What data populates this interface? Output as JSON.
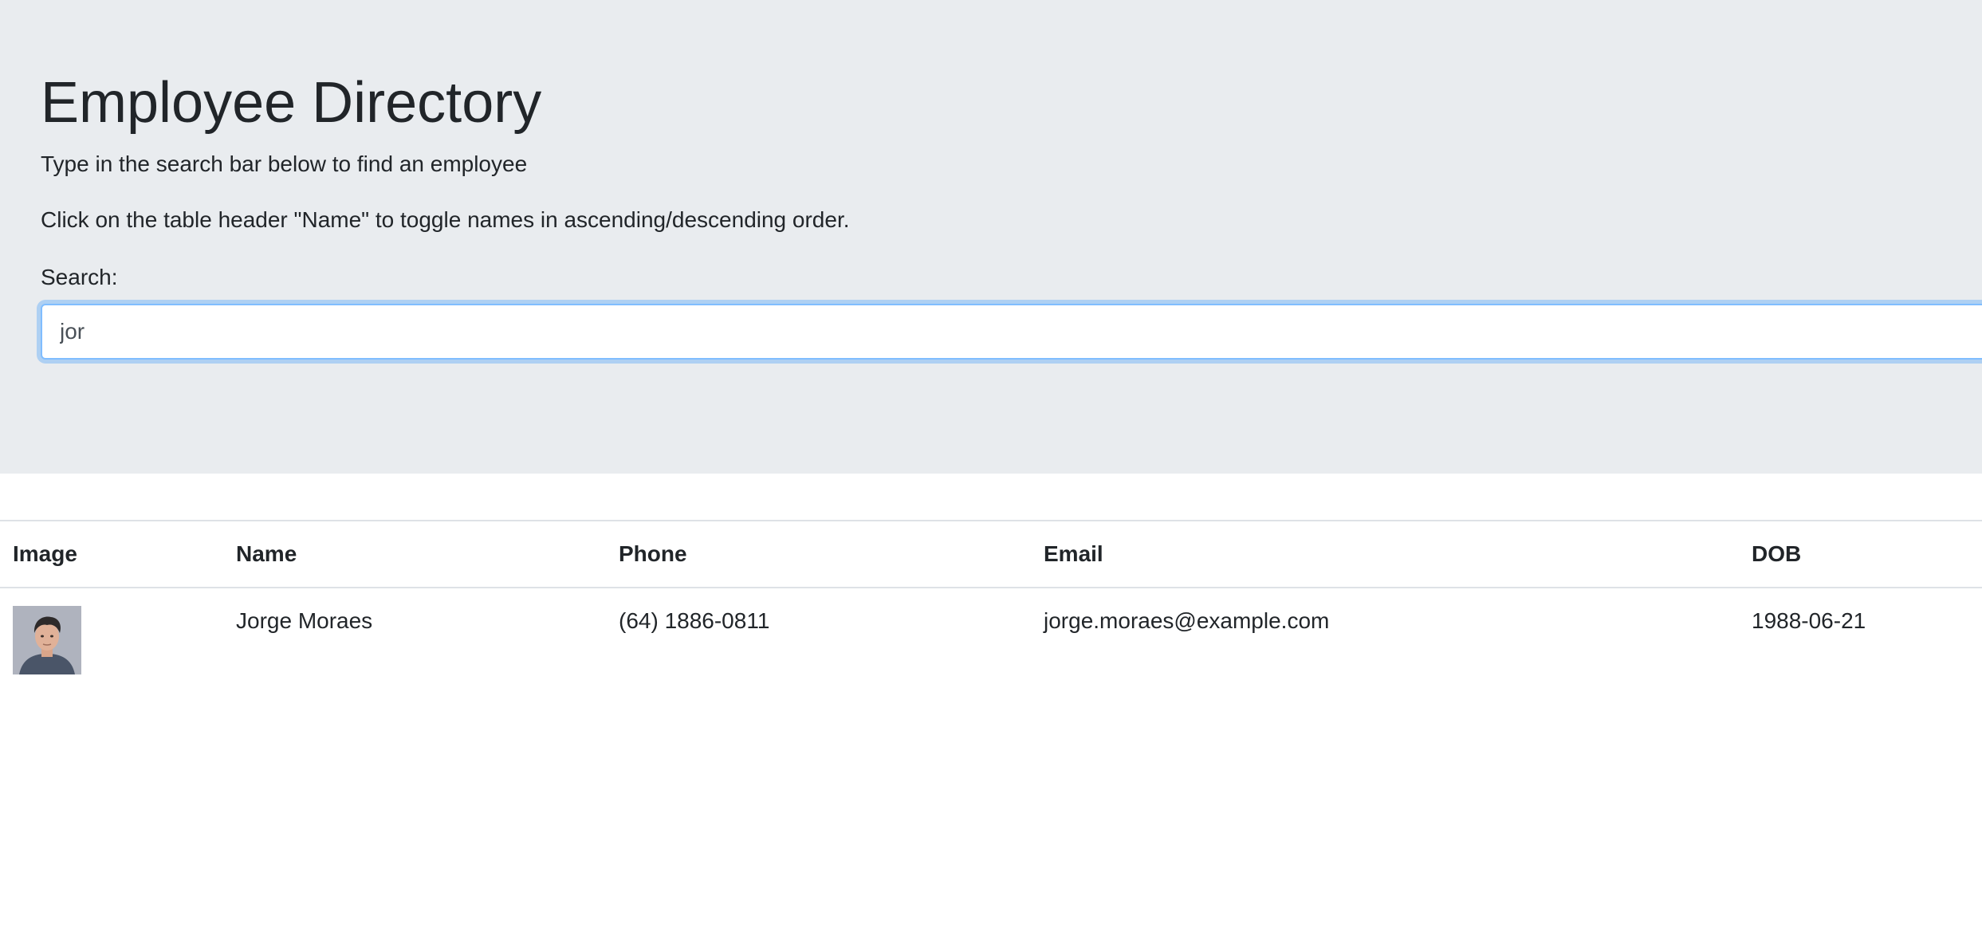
{
  "header": {
    "title": "Employee Directory",
    "instruction_search": "Type in the search bar below to find an employee",
    "instruction_sort": "Click on the table header \"Name\" to toggle names in ascending/descending order."
  },
  "search": {
    "label": "Search:",
    "value": "jor"
  },
  "table": {
    "columns": [
      "Image",
      "Name",
      "Phone",
      "Email",
      "DOB"
    ],
    "rows": [
      {
        "name": "Jorge Moraes",
        "phone": "(64) 1886-0811",
        "email": "jorge.moraes@example.com",
        "dob": "1988-06-21"
      }
    ]
  },
  "colors": {
    "jumbotron_bg": "#e9ecef",
    "focus_border": "#80bdff",
    "text": "#212529"
  }
}
